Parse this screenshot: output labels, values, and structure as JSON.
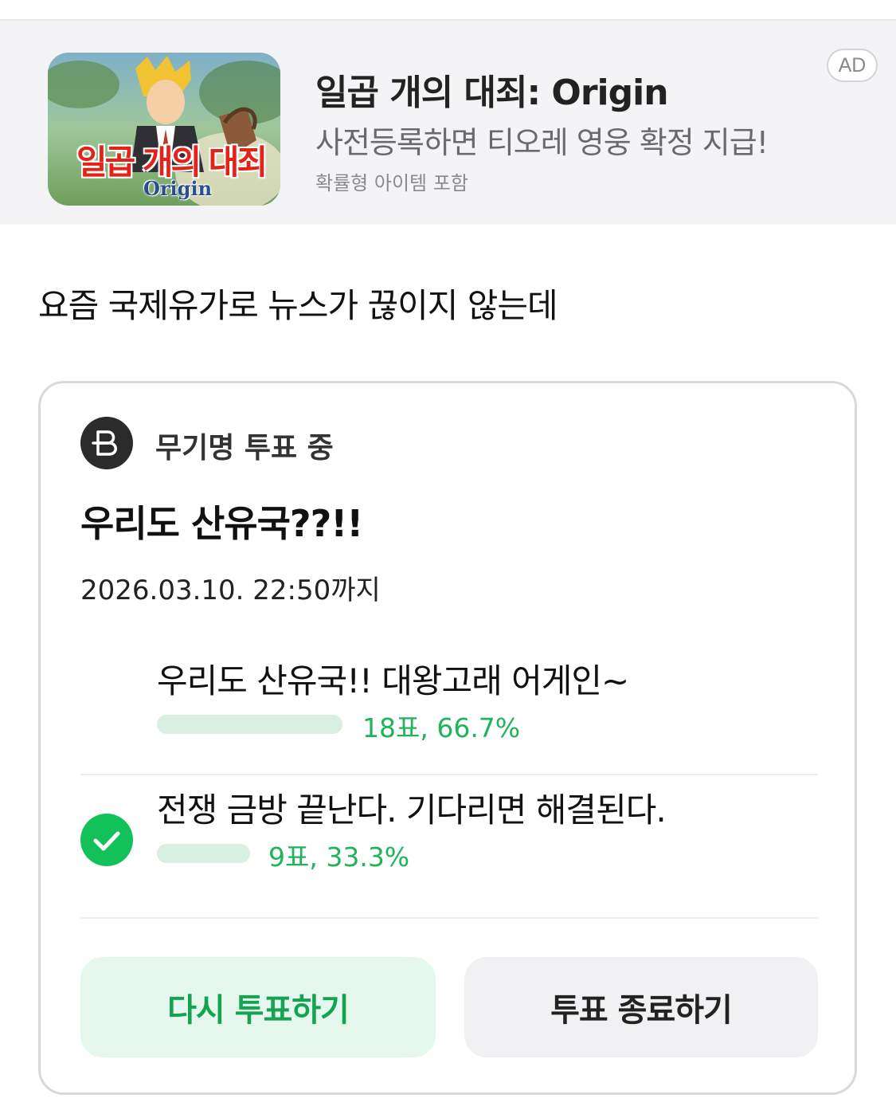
{
  "ad": {
    "thumbnail_text": "일곱 개의 대죄",
    "thumbnail_subtext": "Origin",
    "title": "일곱 개의 대죄: Origin",
    "description": "사전등록하면 티오레 영웅 확정 지급!",
    "note": "확률형 아이템 포함",
    "badge": "AD"
  },
  "post": {
    "text": "요즘 국제유가로 뉴스가 끊이지 않는데"
  },
  "vote": {
    "status": "무기명 투표 중",
    "question": "우리도 산유국??!!",
    "deadline": "2026.03.10. 22:50까지",
    "options": [
      {
        "label": "우리도 산유국!! 대왕고래 어게인~",
        "result": "18표, 66.7%",
        "percent": 66.7,
        "selected": false
      },
      {
        "label": "전쟁 금방 끝난다. 기다리면 해결된다.",
        "result": "9표, 33.3%",
        "percent": 33.3,
        "selected": true
      }
    ],
    "revote_label": "다시 투표하기",
    "end_label": "투표 종료하기"
  },
  "colors": {
    "accent_green": "#1fb35a",
    "bar_fill": "#d8efe2",
    "check_green": "#13c15a"
  },
  "icons": {
    "vote_status": "ballot-icon",
    "selected_option": "check-circle-icon"
  }
}
